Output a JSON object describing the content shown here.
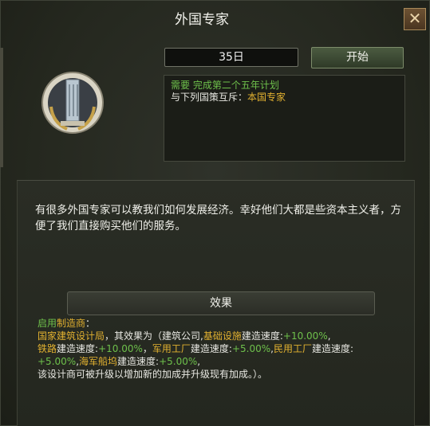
{
  "window": {
    "title": "外国专家"
  },
  "header": {
    "days": "35日",
    "start_label": "开始"
  },
  "icons": {
    "close": "close-icon",
    "emblem": "building-laurel-emblem"
  },
  "requirements": {
    "line1_prefix": "需要",
    "line1_value": "完成第二个五年计划",
    "line2_prefix": "与下列国策互斥：",
    "line2_value": "本国专家"
  },
  "description": "有很多外国专家可以教我们如何发展经济。幸好他们大都是些资本主义者，方便了我们直接购买他们的服务。",
  "effects": {
    "title": "效果",
    "l1_a": "启用",
    "l1_b": "制造商",
    "l1_c": "：",
    "l2_a": "国家建筑设计局",
    "l2_b": "，其效果为（建筑公司,",
    "l2_c": "基础设施",
    "l2_d": "建造速度:",
    "l2_e": "+10.00%",
    "l2_f": ",",
    "l3_a": "铁路",
    "l3_b": "建造速度:",
    "l3_c": "+10.00%",
    "l3_d": "，",
    "l3_e": "军用工厂",
    "l3_f": "建造速度:",
    "l3_g": "+5.00%",
    "l3_h": ",",
    "l3_i": "民用工厂",
    "l3_j": "建造速度:",
    "l4_a": "+5.00%",
    "l4_b": ",",
    "l4_c": "海军船坞",
    "l4_d": "建造速度:",
    "l4_e": "+5.00%",
    "l4_f": ",",
    "l5": "该设计商可被升级以增加新的加成并升级现有加成。）。"
  },
  "colors": {
    "green": "#6ec04b",
    "gold": "#e2b130",
    "background": "#25281f"
  }
}
